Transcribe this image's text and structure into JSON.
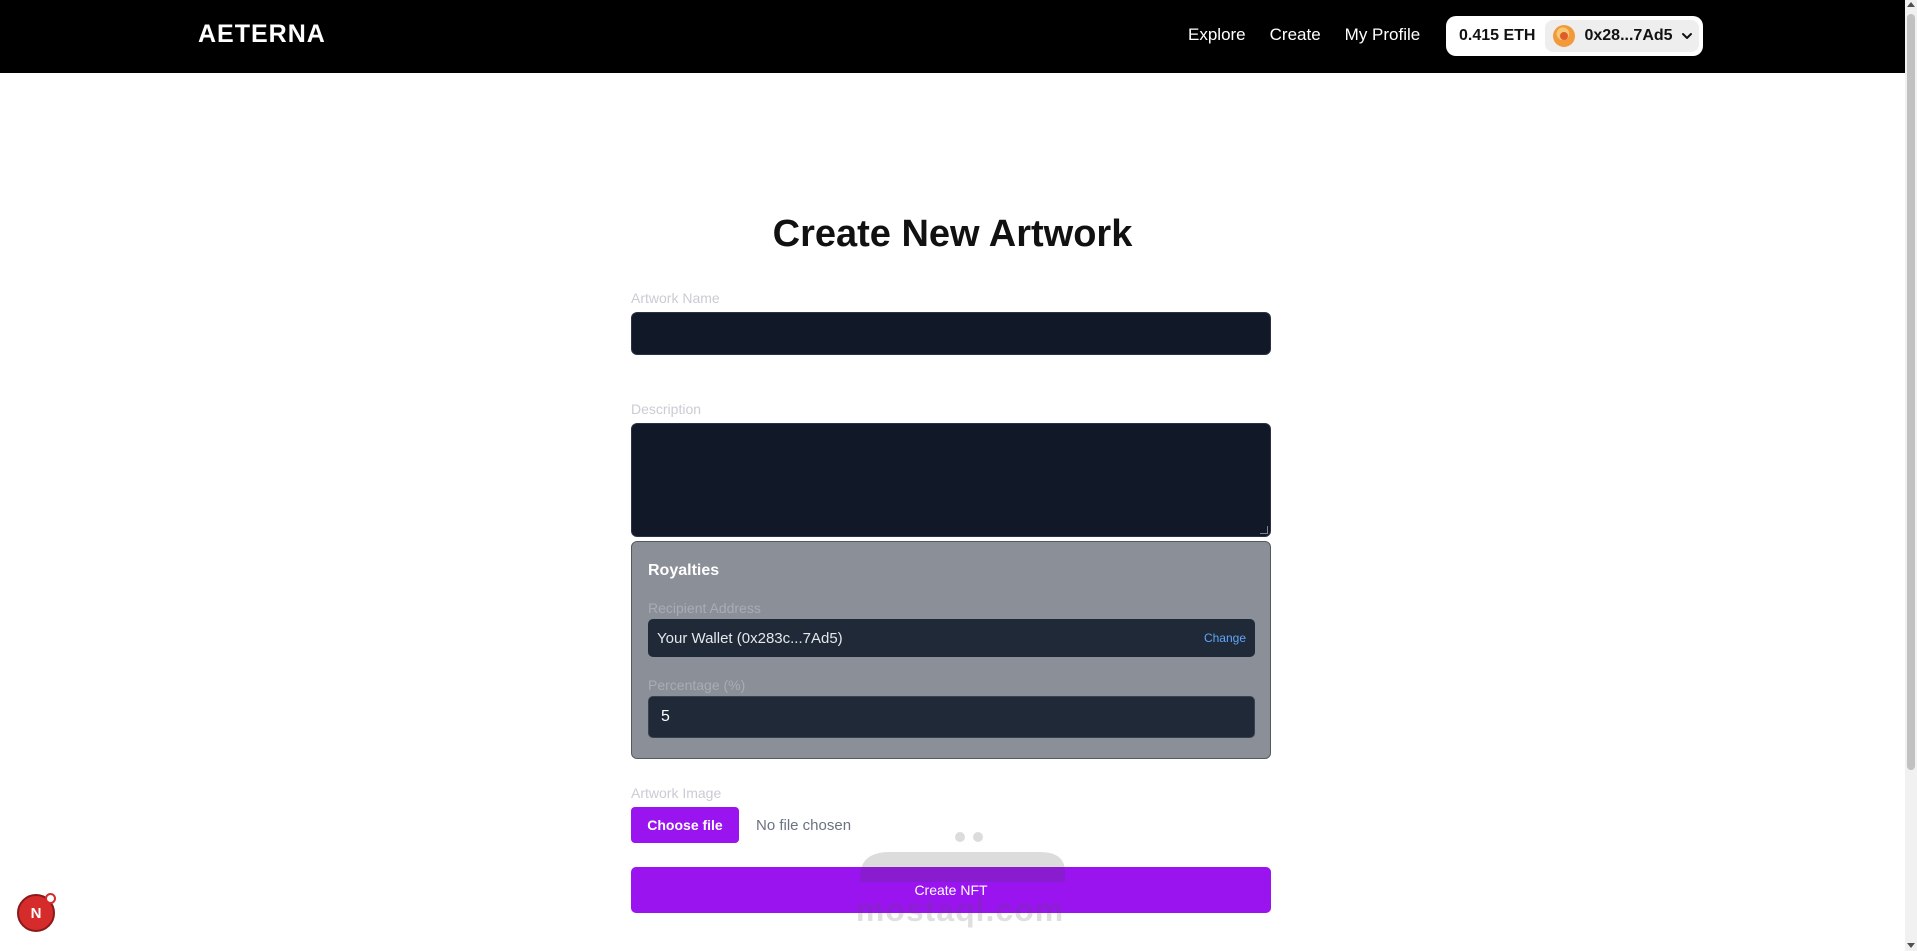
{
  "navbar": {
    "brand": "AETERNA",
    "links": [
      "Explore",
      "Create",
      "My Profile"
    ],
    "wallet": {
      "balance": "0.415 ETH",
      "address": "0x28...7Ad5",
      "avatar_icon": "avatar-icon",
      "dropdown_icon": "chevron-down-icon"
    }
  },
  "page": {
    "title": "Create New Artwork"
  },
  "form": {
    "name_label": "Artwork Name",
    "name_value": "",
    "description_label": "Description",
    "description_value": "",
    "royalties": {
      "title": "Royalties",
      "recipient_label": "Recipient Address",
      "recipient_value": "Your Wallet (0x283c...7Ad5)",
      "change_label": "Change",
      "percentage_label": "Percentage (%)",
      "percentage_value": "5"
    },
    "image_label": "Artwork Image",
    "choose_file_label": "Choose file",
    "file_status": "No file chosen",
    "submit_label": "Create NFT"
  },
  "overlay": {
    "watermark_text": "mostaql.com",
    "dev_badge": "N"
  },
  "colors": {
    "accent": "#9a14f0",
    "nav_bg": "#000000",
    "input_bg": "#111827",
    "panel_bg": "#8b8f98",
    "link": "#60a5fa"
  }
}
